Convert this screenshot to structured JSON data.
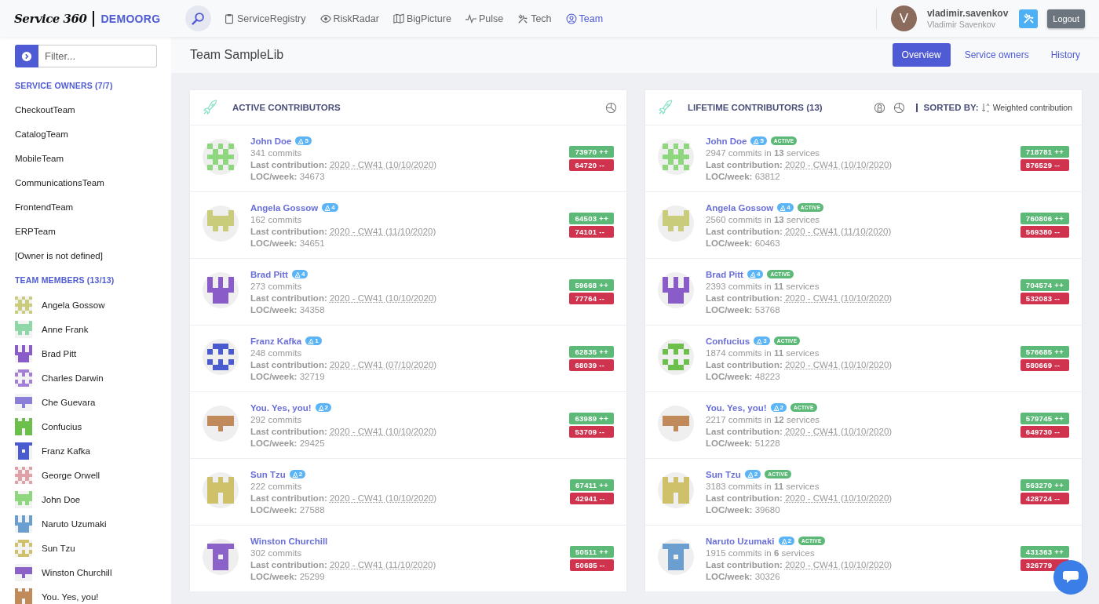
{
  "header": {
    "logo": "Service 360",
    "org": "DEMOORG",
    "nav": [
      {
        "label": "ServiceRegistry",
        "kind": "registry",
        "selected": false
      },
      {
        "label": "RiskRadar",
        "kind": "radar",
        "selected": false
      },
      {
        "label": "BigPicture",
        "kind": "map",
        "selected": false
      },
      {
        "label": "Pulse",
        "kind": "pulse",
        "selected": false
      },
      {
        "label": "Tech",
        "kind": "tech",
        "selected": false
      },
      {
        "label": "Team",
        "kind": "team",
        "selected": true
      }
    ],
    "user": {
      "initial": "V",
      "login": "vladimir.savenkov",
      "name": "Vladimir Savenkov"
    },
    "logout": "Logout"
  },
  "sidebar": {
    "filter": {
      "placeholder": "Filter..."
    },
    "owners_heading": "SERVICE OWNERS (7/7)",
    "owners": [
      "CheckoutTeam",
      "CatalogTeam",
      "MobileTeam",
      "CommunicationsTeam",
      "FrontendTeam",
      "ERPTeam",
      "[Owner is not defined]"
    ],
    "members_heading": "TEAM MEMBERS (13/13)",
    "members": [
      {
        "name": "Angela Gossow",
        "color": "#c9cc7a"
      },
      {
        "name": "Anne Frank",
        "color": "#8fd7a8"
      },
      {
        "name": "Brad Pitt",
        "color": "#8a5cc9"
      },
      {
        "name": "Charles Darwin",
        "color": "#a57ed8"
      },
      {
        "name": "Che Guevara",
        "color": "#8a7fd8"
      },
      {
        "name": "Confucius",
        "color": "#6cbf4a"
      },
      {
        "name": "Franz Kafka",
        "color": "#4a5bd0"
      },
      {
        "name": "George Orwell",
        "color": "#e0a0a8"
      },
      {
        "name": "John Doe",
        "color": "#8fd77e"
      },
      {
        "name": "Naruto Uzumaki",
        "color": "#6a9fd0"
      },
      {
        "name": "Sun Tzu",
        "color": "#cfc06a"
      },
      {
        "name": "Winston Churchill",
        "color": "#8a62c8"
      },
      {
        "name": "You. Yes, you!",
        "color": "#c08a5a"
      }
    ]
  },
  "page": {
    "title": "Team SampleLib",
    "tabs": [
      {
        "label": "Overview",
        "selected": true
      },
      {
        "label": "Service owners",
        "selected": false
      },
      {
        "label": "History",
        "selected": false
      }
    ]
  },
  "cards": [
    {
      "title": "ACTIVE CONTRIBUTORS",
      "contributors": [
        {
          "name": "John Doe",
          "badge": "5",
          "commits": "341 commits",
          "last_label": "Last contribution:",
          "last": "2020 - CW41 (10/10/2020)",
          "loc_label": "LOC/week:",
          "loc": "34673",
          "added": "73970 ++",
          "removed": "64720 --",
          "color": "#8fd77e"
        },
        {
          "name": "Angela Gossow",
          "badge": "4",
          "commits": "162 commits",
          "last_label": "Last contribution:",
          "last": "2020 - CW41 (11/10/2020)",
          "loc_label": "LOC/week:",
          "loc": "34651",
          "added": "64503 ++",
          "removed": "74101 --",
          "color": "#c9cc7a"
        },
        {
          "name": "Brad Pitt",
          "badge": "4",
          "commits": "273 commits",
          "last_label": "Last contribution:",
          "last": "2020 - CW41 (10/10/2020)",
          "loc_label": "LOC/week:",
          "loc": "34358",
          "added": "59668 ++",
          "removed": "77764 --",
          "color": "#8a5cc9"
        },
        {
          "name": "Franz Kafka",
          "badge": "1",
          "commits": "248 commits",
          "last_label": "Last contribution:",
          "last": "2020 - CW41 (07/10/2020)",
          "loc_label": "LOC/week:",
          "loc": "32719",
          "added": "62835 ++",
          "removed": "68039 --",
          "color": "#4a5bd0"
        },
        {
          "name": "You. Yes, you!",
          "badge": "2",
          "commits": "292 commits",
          "last_label": "Last contribution:",
          "last": "2020 - CW41 (10/10/2020)",
          "loc_label": "LOC/week:",
          "loc": "29425",
          "added": "63989 ++",
          "removed": "53709 --",
          "color": "#c08a5a"
        },
        {
          "name": "Sun Tzu",
          "badge": "2",
          "commits": "222 commits",
          "last_label": "Last contribution:",
          "last": "2020 - CW41 (10/10/2020)",
          "loc_label": "LOC/week:",
          "loc": "27588",
          "added": "67411 ++",
          "removed": "42941 --",
          "color": "#cfc06a"
        },
        {
          "name": "Winston Churchill",
          "commits": "302 commits",
          "last_label": "Last contribution:",
          "last": "2020 - CW41 (11/10/2020)",
          "loc_label": "LOC/week:",
          "loc": "25299",
          "added": "50511 ++",
          "removed": "50685 --",
          "color": "#8a62c8"
        }
      ]
    },
    {
      "title": "LIFETIME CONTRIBUTORS (13)",
      "sort_label": "SORTED BY:",
      "sort_value": "Weighted contribution",
      "contributors": [
        {
          "name": "John Doe",
          "badge": "5",
          "tag": "ACTIVE",
          "commits": "2947 commits in **13** services",
          "last_label": "Last contribution:",
          "last": "2020 - CW41 (10/10/2020)",
          "loc_label": "LOC/week:",
          "loc": "63812",
          "added": "718781 ++",
          "removed": "876529 --",
          "color": "#8fd77e"
        },
        {
          "name": "Angela Gossow",
          "badge": "4",
          "tag": "ACTIVE",
          "commits": "2560 commits in **13** services",
          "last_label": "Last contribution:",
          "last": "2020 - CW41 (11/10/2020)",
          "loc_label": "LOC/week:",
          "loc": "60463",
          "added": "760806 ++",
          "removed": "569380 --",
          "color": "#c9cc7a"
        },
        {
          "name": "Brad Pitt",
          "badge": "4",
          "tag": "ACTIVE",
          "commits": "2393 commits in **11** services",
          "last_label": "Last contribution:",
          "last": "2020 - CW41 (10/10/2020)",
          "loc_label": "LOC/week:",
          "loc": "53768",
          "added": "704574 ++",
          "removed": "532083 --",
          "color": "#8a5cc9"
        },
        {
          "name": "Confucius",
          "badge": "3",
          "tag": "ACTIVE",
          "commits": "1874 commits in **11** services",
          "last_label": "Last contribution:",
          "last": "2020 - CW41 (10/10/2020)",
          "loc_label": "LOC/week:",
          "loc": "48223",
          "added": "576685 ++",
          "removed": "580669 --",
          "color": "#6cbf4a"
        },
        {
          "name": "You. Yes, you!",
          "badge": "2",
          "tag": "ACTIVE",
          "commits": "2217 commits in **12** services",
          "last_label": "Last contribution:",
          "last": "2020 - CW41 (10/10/2020)",
          "loc_label": "LOC/week:",
          "loc": "51228",
          "added": "579745 ++",
          "removed": "649730 --",
          "color": "#c08a5a"
        },
        {
          "name": "Sun Tzu",
          "badge": "2",
          "tag": "ACTIVE",
          "commits": "3183 commits in **11** services",
          "last_label": "Last contribution:",
          "last": "2020 - CW41 (10/10/2020)",
          "loc_label": "LOC/week:",
          "loc": "39680",
          "added": "563270 ++",
          "removed": "428724 --",
          "color": "#cfc06a"
        },
        {
          "name": "Naruto Uzumaki",
          "badge": "2",
          "tag": "ACTIVE",
          "commits": "1915 commits in **6** services",
          "last_label": "Last contribution:",
          "last": "2020 - CW41 (10/10/2020)",
          "loc_label": "LOC/week:",
          "loc": "30326",
          "added": "431363 ++",
          "removed": "326779",
          "color": "#6a9fd0"
        }
      ]
    }
  ]
}
